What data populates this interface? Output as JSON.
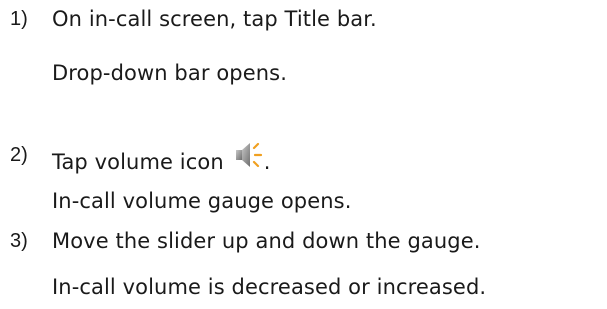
{
  "steps": [
    {
      "number": "1)",
      "instruction": "On in-call screen, tap Title bar.",
      "result": "Drop-down bar opens."
    },
    {
      "number": "2)",
      "instruction_before_icon": "Tap volume icon",
      "icon": "speaker-volume-icon",
      "instruction_after_icon": ".",
      "result": "In-call volume gauge opens."
    },
    {
      "number": "3)",
      "instruction": "Move the slider up and down the gauge.",
      "result": "In-call volume is decreased or increased."
    }
  ],
  "colors": {
    "text": "#1a1a1a",
    "icon_body": "#8a8a8a",
    "icon_waves": "#f0a020"
  }
}
